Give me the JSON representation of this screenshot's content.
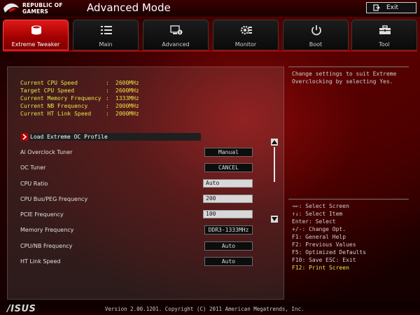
{
  "header": {
    "brand_line1": "REPUBLIC OF",
    "brand_line2": "GAMERS",
    "mode_title": "Advanced Mode",
    "exit_label": "Exit"
  },
  "tabs": [
    {
      "label": "Extreme Tweaker",
      "icon": "tweaker-icon",
      "active": true
    },
    {
      "label": "Main",
      "icon": "list-icon",
      "active": false
    },
    {
      "label": "Advanced",
      "icon": "advanced-info-icon",
      "active": false
    },
    {
      "label": "Monitor",
      "icon": "monitor-gear-icon",
      "active": false
    },
    {
      "label": "Boot",
      "icon": "power-icon",
      "active": false
    },
    {
      "label": "Tool",
      "icon": "toolbox-icon",
      "active": false
    }
  ],
  "info": [
    {
      "label": "Current CPU Speed",
      "sep": ":",
      "value": "2600MHz"
    },
    {
      "label": "Target CPU Speed",
      "sep": ":",
      "value": "2600MHz"
    },
    {
      "label": "Current Memory Frequency",
      "sep": ":",
      "value": "1333MHz"
    },
    {
      "label": "Current NB Frequency",
      "sep": ":",
      "value": "2000MHz"
    },
    {
      "label": "Current HT Link Speed",
      "sep": ":",
      "value": "2000MHz"
    }
  ],
  "profile_label": "Load Extreme OC Profile",
  "settings": [
    {
      "name": "Ai Overclock Tuner",
      "value": "Manual",
      "kind": "dropdown"
    },
    {
      "name": "OC Tuner",
      "value": "CANCEL",
      "kind": "dropdown"
    },
    {
      "name": "CPU Ratio",
      "value": "Auto",
      "kind": "field"
    },
    {
      "name": "CPU Bus/PEG Frequency",
      "value": "200",
      "kind": "field"
    },
    {
      "name": "PCIE Frequency",
      "value": "100",
      "kind": "field"
    },
    {
      "name": "Memory Frequency",
      "value": "DDR3-1333MHz",
      "kind": "dropdown"
    },
    {
      "name": "CPU/NB Frequency",
      "value": "Auto",
      "kind": "dropdown"
    },
    {
      "name": "HT Link Speed",
      "value": "Auto",
      "kind": "dropdown"
    }
  ],
  "help": {
    "description": "Change settings to suit Extreme Overclocking by selecting Yes.",
    "keys": [
      "→←: Select Screen",
      "↑↓: Select Item",
      "Enter: Select",
      "+/-: Change Opt.",
      "F1: General Help",
      "F2: Previous Values",
      "F5: Optimized Defaults",
      "F10: Save  ESC: Exit",
      "F12: Print Screen"
    ]
  },
  "footer": {
    "brand": "/ISUS",
    "version": "Version 2.00.1201. Copyright (C) 2011 American Megatrends, Inc."
  },
  "colors": {
    "accent_red": "#b00000",
    "tab_active": "#e01818",
    "info_yellow": "#e8e44a",
    "highlight_key": "#f0e24a"
  }
}
